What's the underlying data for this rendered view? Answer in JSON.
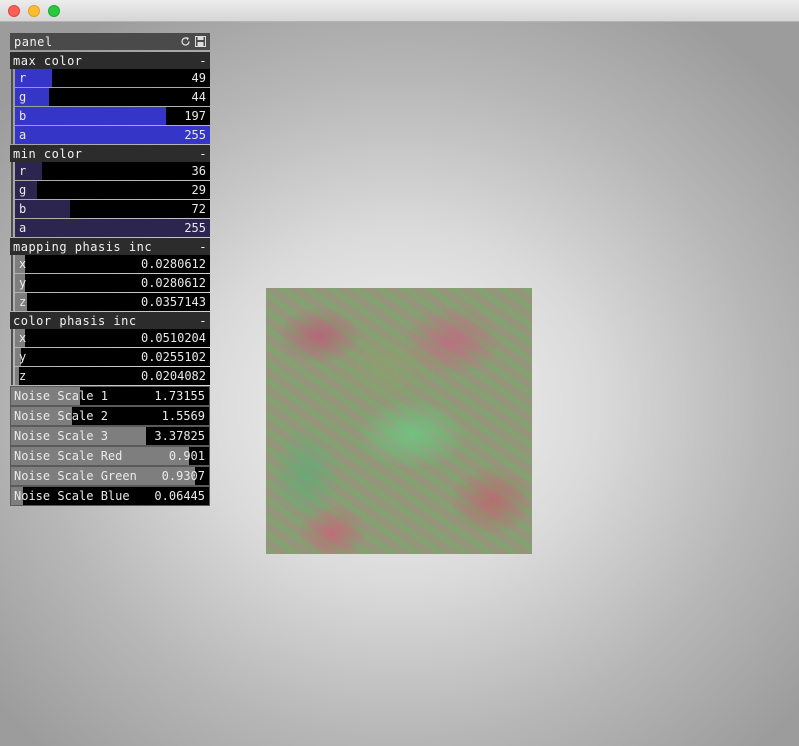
{
  "window": {
    "buttons": [
      "close",
      "minimize",
      "maximize"
    ]
  },
  "panel": {
    "title": "panel",
    "icons": [
      "refresh-icon",
      "save-icon"
    ],
    "groups": [
      {
        "title": "max color",
        "toggle": "-",
        "rows": [
          {
            "label": "r",
            "value": "49",
            "fraction": 0.192
          },
          {
            "label": "g",
            "value": "44",
            "fraction": 0.173
          },
          {
            "label": "b",
            "value": "197",
            "fraction": 0.773
          },
          {
            "label": "a",
            "value": "255",
            "fraction": 1.0
          }
        ]
      },
      {
        "title": "min color",
        "toggle": "-",
        "rows": [
          {
            "label": "r",
            "value": "36",
            "fraction": 0.141
          },
          {
            "label": "g",
            "value": "29",
            "fraction": 0.114
          },
          {
            "label": "b",
            "value": "72",
            "fraction": 0.282
          },
          {
            "label": "a",
            "value": "255",
            "fraction": 1.0
          }
        ]
      },
      {
        "title": "mapping phasis inc",
        "toggle": "-",
        "rows": [
          {
            "label": "x",
            "value": "0.0280612",
            "fraction": 0.05
          },
          {
            "label": "y",
            "value": "0.0280612",
            "fraction": 0.05
          },
          {
            "label": "z",
            "value": "0.0357143",
            "fraction": 0.06
          }
        ]
      },
      {
        "title": "color phasis inc",
        "toggle": "-",
        "rows": [
          {
            "label": "x",
            "value": "0.0510204",
            "fraction": 0.05
          },
          {
            "label": "y",
            "value": "0.0255102",
            "fraction": 0.03
          },
          {
            "label": "z",
            "value": "0.0204082",
            "fraction": 0.02
          }
        ]
      }
    ],
    "sliders": [
      {
        "label": "Noise Scale 1",
        "value": "1.73155",
        "fraction": 0.35
      },
      {
        "label": "Noise Scale 2",
        "value": "1.5569",
        "fraction": 0.31
      },
      {
        "label": "Noise Scale 3",
        "value": "3.37825",
        "fraction": 0.68
      },
      {
        "label": "Noise Scale Red",
        "value": "0.901",
        "fraction": 0.9
      },
      {
        "label": "Noise Scale Green",
        "value": "0.9307",
        "fraction": 0.93
      },
      {
        "label": "Noise Scale Blue",
        "value": "0.06445",
        "fraction": 0.06
      }
    ]
  },
  "colors": {
    "max_fill": "#3535c8",
    "min_fill": "#2b2550",
    "gray_fill": "#7e7e7e"
  }
}
